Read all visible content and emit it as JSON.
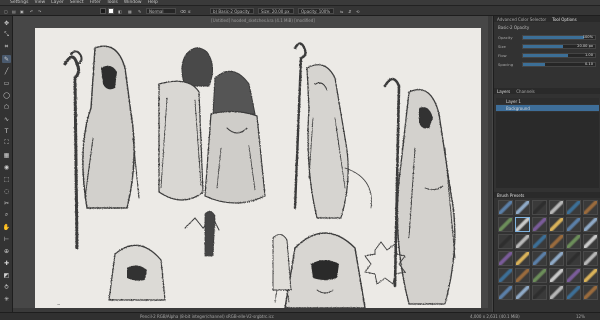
{
  "menubar": {
    "items": [
      "",
      "Settings",
      "View",
      "Layer",
      "Select",
      "Filter",
      "Tools",
      "Window",
      "Help"
    ]
  },
  "tool_options": {
    "blend_mode": "Normal",
    "brush_label": "b) Basic-2 Opacity",
    "size_label": "Size: 20.00 px",
    "opacity_label": "Opacity: 100%",
    "fg_color": "#1a1a1a",
    "bg_color": "#ffffff"
  },
  "document": {
    "title": "[Untitled] hooded_sketches.kra (4.1 MiB) [modified]"
  },
  "toolbox": {
    "icons": [
      "move-icon",
      "transform-icon",
      "crop-icon",
      "brush-icon",
      "line-icon",
      "rect-icon",
      "ellipse-icon",
      "polygon-icon",
      "path-icon",
      "text-icon",
      "fill-icon",
      "gradient-icon",
      "picker-icon",
      "select-rect-icon",
      "select-ellipse-icon",
      "select-freehand-icon",
      "zoom-icon",
      "pan-icon",
      "measure-icon",
      "assistant-icon",
      "smart-patch-icon",
      "colorize-icon",
      "dynamic-brush-icon",
      "multibrush-icon"
    ],
    "glyphs": [
      "✥",
      "⤡",
      "⌗",
      "✎",
      "╱",
      "▭",
      "◯",
      "⬠",
      "∿",
      "T",
      "⛶",
      "▦",
      "◉",
      "⬚",
      "◌",
      "✂",
      "⌕",
      "✋",
      "⊢",
      "⊕",
      "✚",
      "◩",
      "⥁",
      "✳"
    ],
    "active_index": 3
  },
  "dock": {
    "top_tabs": [
      "Advanced Color Selector",
      "Tool Options"
    ],
    "panel_title": "Basic-2 Opacity",
    "sliders": [
      {
        "label": "Opacity",
        "value": "100%",
        "fill": 0.85
      },
      {
        "label": "Size",
        "value": "20.00 px",
        "fill": 0.55
      },
      {
        "label": "Flow",
        "value": "1.00",
        "fill": 0.62
      },
      {
        "label": "Spacing",
        "value": "0.10",
        "fill": 0.3
      }
    ],
    "layer_tabs": [
      "Layers",
      "Channels"
    ],
    "layers": [
      {
        "name": "Layer 1",
        "selected": false
      },
      {
        "name": "Background",
        "selected": true
      }
    ],
    "brush_presets_title": "Brush Presets",
    "brush_count": 36
  },
  "status": {
    "left_text": "Pencil-2 RGB/Alpha (8-bit integer/channel) sRGB-elle-V2-srgbtrc.icc",
    "right_text": "4,000 x 2,631 (40.1 MiB)",
    "zoom": "12%"
  },
  "colors": {
    "accent": "#3e6e99",
    "paper": "#eceae6",
    "ink": "#3b3b3b"
  }
}
